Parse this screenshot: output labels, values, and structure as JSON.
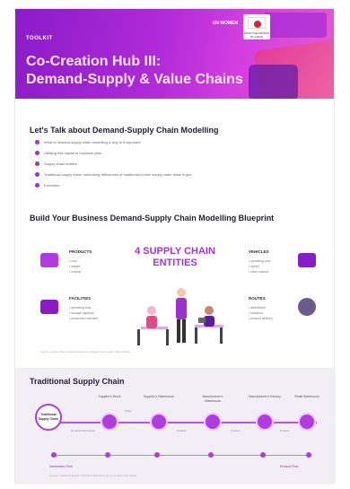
{
  "header": {
    "toolkit": "TOOLKIT",
    "title_line1": "Co-Creation Hub III:",
    "title_line2": "Demand-Supply & Value Chains",
    "logo_un": "UN WOMEN",
    "logo_jp_caption": "FROM THE PEOPLE OF JAPAN"
  },
  "section1": {
    "title": "Let's Talk about Demand-Supply Chain Modelling",
    "bullets": [
      "What is demand-supply chain modelling & why is it important",
      "Utilising this capital in business plan",
      "Supply chain entities",
      "Traditional supply chain: describing differences of traditional-to-mini supply chain flows in gov",
      "Exercises"
    ]
  },
  "section2": {
    "title": "Build Your Business Demand-Supply Chain Modelling Blueprint",
    "center": "4 SUPPLY CHAIN ENTITIES",
    "entities": {
      "products": {
        "label": "PRODUCTS",
        "items": [
          "cost",
          "weight",
          "volume"
        ]
      },
      "facilities": {
        "label": "FACILITIES",
        "items": [
          "operating cost",
          "storage capacity",
          "production demand"
        ]
      },
      "vehicles": {
        "label": "VEHICLES",
        "items": [
          "operating cost",
          "speed",
          "carry volume"
        ]
      },
      "routes": {
        "label": "ROUTES",
        "items": [
          "distribution",
          "selection",
          "product delivery"
        ]
      }
    },
    "footnote": "Source: supply chain entities description adapted from supply chain studies"
  },
  "section3": {
    "title": "Traditional Supply Chain",
    "start_node": "Traditional Supply Chain",
    "nodes": [
      "Supplier's Stock",
      "Supplier's Warehouse",
      "Manufacturer's Warehouse",
      "Manufacturer's Factory",
      "Retail Warehouse"
    ],
    "flow_labels": [
      "Demand Information",
      "Order",
      "Product",
      "Product",
      "Product"
    ],
    "information_flow": "Information Flow",
    "product_flow": "Product Flow",
    "footnote": "Source: traditional supply chain flow illustration for co-creation hub toolkit"
  },
  "colors": {
    "accent": "#a830e0",
    "banner": "#b02ad8",
    "heading": "#1e1e3c"
  }
}
